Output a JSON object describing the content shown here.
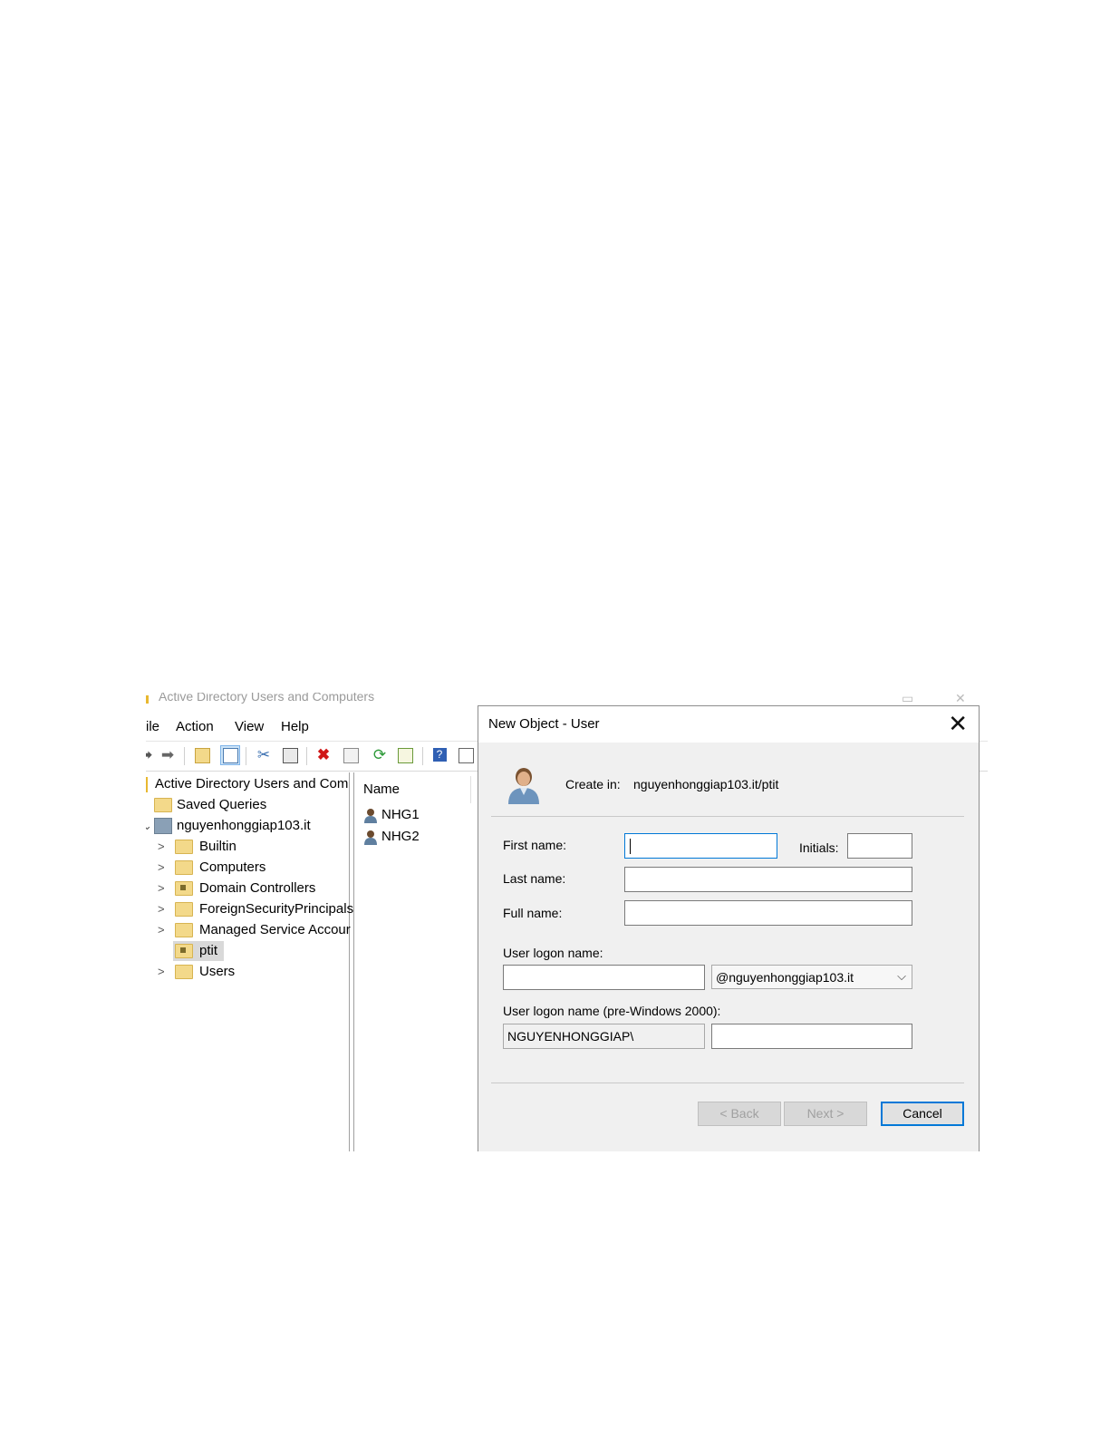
{
  "mmc": {
    "window_title": "Active Directory Users and Computers",
    "menu": [
      "ile",
      "Action",
      "View",
      "Help"
    ],
    "tree": {
      "root": "Active Directory Users and Com",
      "saved_queries": "Saved Queries",
      "domain": "nguyenhonggiap103.it",
      "children": [
        "Builtin",
        "Computers",
        "Domain Controllers",
        "ForeignSecurityPrincipals",
        "Managed Service Accour",
        "ptit",
        "Users"
      ]
    },
    "list": {
      "column_name": "Name",
      "items": [
        "NHG1",
        "NHG2"
      ]
    }
  },
  "dialog": {
    "title": "New Object - User",
    "create_in_label": "Create in:",
    "create_in_path": "nguyenhonggiap103.it/ptit",
    "first_name_label": "First name:",
    "initials_label": "Initials:",
    "last_name_label": "Last name:",
    "full_name_label": "Full name:",
    "logon_name_label": "User logon name:",
    "upn_suffix": "@nguyenhonggiap103.it",
    "pre2000_label": "User logon name (pre-Windows 2000):",
    "pre2000_domain": "NGUYENHONGGIAP\\",
    "fields": {
      "first_name": "",
      "initials": "",
      "last_name": "",
      "full_name": "",
      "logon_name": "",
      "pre2000_name": ""
    },
    "buttons": {
      "back": "< Back",
      "next": "Next >",
      "cancel": "Cancel"
    }
  }
}
